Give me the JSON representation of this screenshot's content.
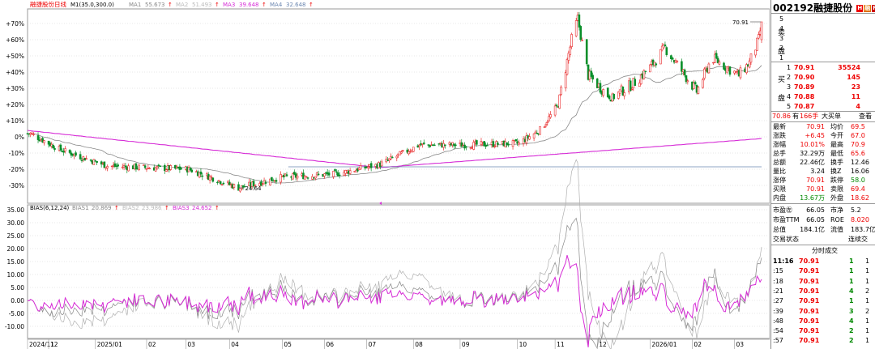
{
  "colors": {
    "up": "#e8292a",
    "down": "#0a8f2a",
    "ma1": "#888888",
    "ma3": "#d62bd6",
    "ma4": "#6a86b0",
    "grid": "#cfcfcf",
    "bias": "#d62bd6",
    "bias2": "#888888",
    "bias3": "#b0b0b0"
  },
  "chart_data": [
    {
      "type": "candlestick",
      "legend": {
        "name": "融捷股份日线",
        "params": "M1(35.0,300.0)",
        "items": [
          {
            "label": "MA1",
            "value": "55.673",
            "arrow": "↑"
          },
          {
            "label": "MA2",
            "value": "51.493",
            "arrow": "↑"
          },
          {
            "label": "MA3",
            "value": "39.648",
            "arrow": "↑"
          },
          {
            "label": "MA4",
            "value": "32.648",
            "arrow": "↑"
          }
        ]
      },
      "y_ticks": [
        "+70%",
        "+60%",
        "+50%",
        "+40%",
        "+30%",
        "+20%",
        "+10%",
        "0%",
        "-10%",
        "-20%",
        "-30%"
      ],
      "ylim": [
        -37,
        74
      ],
      "annotations": [
        {
          "label": "70.91",
          "y": 71
        },
        {
          "label": "24.64",
          "y": -31.5
        }
      ],
      "key_points": [
        {
          "x": "2024-11-20",
          "y": 2
        },
        {
          "x": "2024-12-10",
          "y": -8
        },
        {
          "x": "2025-01-10",
          "y": -18
        },
        {
          "x": "2025-02-05",
          "y": -19
        },
        {
          "x": "2025-03-05",
          "y": -20
        },
        {
          "x": "2025-04-07",
          "y": -31.5
        },
        {
          "x": "2025-05-05",
          "y": -25
        },
        {
          "x": "2025-06-10",
          "y": -23
        },
        {
          "x": "2025-07-10",
          "y": -17
        },
        {
          "x": "2025-08-05",
          "y": -5
        },
        {
          "x": "2025-09-05",
          "y": -5
        },
        {
          "x": "2025-10-10",
          "y": -4
        },
        {
          "x": "2025-10-25",
          "y": 5
        },
        {
          "x": "2025-11-05",
          "y": 20
        },
        {
          "x": "2025-11-14",
          "y": 60
        },
        {
          "x": "2025-11-18",
          "y": 73
        },
        {
          "x": "2025-11-25",
          "y": 38
        },
        {
          "x": "2025-12-10",
          "y": 24
        },
        {
          "x": "2025-12-25",
          "y": 33
        },
        {
          "x": "2026-01-05",
          "y": 43
        },
        {
          "x": "2026-01-15",
          "y": 55
        },
        {
          "x": "2026-01-25",
          "y": 42
        },
        {
          "x": "2026-02-05",
          "y": 28
        },
        {
          "x": "2026-02-15",
          "y": 49
        },
        {
          "x": "2026-03-05",
          "y": 38
        },
        {
          "x": "2026-03-12",
          "y": 46
        },
        {
          "x": "2026-03-18",
          "y": 60
        },
        {
          "x": "2026-03-20",
          "y": 71
        }
      ]
    },
    {
      "type": "line",
      "legend": {
        "name": "BIAS(6,12,24)",
        "items": [
          {
            "label": "BIAS1",
            "value": "20.869",
            "arrow": "↑"
          },
          {
            "label": "BIAS2",
            "value": "23.986",
            "arrow": "↑"
          },
          {
            "label": "BIAS3",
            "value": "24.652",
            "arrow": "↑"
          }
        ]
      },
      "y_ticks": [
        "35.00",
        "30.00",
        "25.00",
        "20.00",
        "15.00",
        "10.00",
        "5.00",
        "0.00",
        "-5.00",
        "-10.00"
      ],
      "ylim": [
        -14,
        36
      ]
    }
  ],
  "x_axis_labels": [
    "2024/11",
    "12",
    "2025/01",
    "02",
    "03",
    "04",
    "05",
    "06",
    "07",
    "08",
    "09",
    "10",
    "11",
    "12",
    "2026/01",
    "02",
    "03"
  ],
  "quote": {
    "code": "002192",
    "name": "融捷股份",
    "badges": [
      "H",
      "融",
      "R"
    ],
    "sell_label": [
      "卖",
      "盘"
    ],
    "buy_label": [
      "买",
      "盘"
    ],
    "sell": [
      {
        "level": "5",
        "price": "",
        "vol": ""
      },
      {
        "level": "4",
        "price": "",
        "vol": ""
      },
      {
        "level": "3",
        "price": "",
        "vol": ""
      },
      {
        "level": "2",
        "price": "",
        "vol": ""
      },
      {
        "level": "1",
        "price": "",
        "vol": ""
      }
    ],
    "buy": [
      {
        "level": "1",
        "price": "70.91",
        "vol": "35524"
      },
      {
        "level": "2",
        "price": "70.90",
        "vol": "145"
      },
      {
        "level": "3",
        "price": "70.89",
        "vol": "23"
      },
      {
        "level": "4",
        "price": "70.88",
        "vol": "11"
      },
      {
        "level": "5",
        "price": "70.87",
        "vol": "4"
      }
    ],
    "big_order": {
      "price": "70.86",
      "has": "有",
      "lots": "166手",
      "label": "大买单",
      "link": "查看"
    },
    "stats": [
      {
        "k1": "最新",
        "v1": "70.91",
        "k2": "均价",
        "v2": "69.5"
      },
      {
        "k1": "涨跌",
        "v1": "+6.45",
        "k2": "今开",
        "v2": "67.0"
      },
      {
        "k1": "涨幅",
        "v1": "10.01%",
        "k2": "最高",
        "v2": "70.9"
      },
      {
        "k1": "总手",
        "v1": "32.29万",
        "k2": "最低",
        "v2": "65.6"
      },
      {
        "k1": "总额",
        "v1": "22.46亿",
        "k2": "换手",
        "v2": "12.46"
      },
      {
        "k1": "量比",
        "v1": "3.24",
        "k2": "换Z",
        "v2": "16.06"
      },
      {
        "k1": "涨停",
        "v1": "70.91",
        "k2": "跌停",
        "v2": "58.0"
      },
      {
        "k1": "买限",
        "v1": "70.91",
        "k2": "卖限",
        "v2": "69.4"
      },
      {
        "k1": "内盘",
        "v1": "13.67万",
        "k2": "外盘",
        "v2": "18.62"
      }
    ],
    "valuation": [
      {
        "k1": "市盈㊧",
        "v1": "66.05",
        "k2": "市净",
        "v2": "5.2"
      },
      {
        "k1": "市盈TTM",
        "v1": "66.05",
        "k2": "ROE",
        "v2": "8.020"
      },
      {
        "k1": "总值",
        "v1": "184.1亿",
        "k2": "流值",
        "v2": "183.7亿"
      }
    ],
    "trade_status": "交易状态",
    "trade_right": "连续交",
    "tick_title": "分时成交",
    "ticks": [
      {
        "time": "11:16",
        "price": "70.91",
        "vol": "1",
        "n": "1"
      },
      {
        "time": ":15",
        "price": "70.91",
        "vol": "1",
        "n": "1"
      },
      {
        "time": ":18",
        "price": "70.91",
        "vol": "1",
        "n": "1"
      },
      {
        "time": ":21",
        "price": "70.91",
        "vol": "4",
        "n": "2"
      },
      {
        "time": ":27",
        "price": "70.91",
        "vol": "1",
        "n": "1"
      },
      {
        "time": ":39",
        "price": "70.91",
        "vol": "3",
        "n": "2"
      },
      {
        "time": ":48",
        "price": "70.91",
        "vol": "4",
        "n": "1"
      },
      {
        "time": ":54",
        "price": "70.91",
        "vol": "2",
        "n": "1"
      },
      {
        "time": ":57",
        "price": "70.91",
        "vol": "2",
        "n": "1"
      }
    ]
  }
}
